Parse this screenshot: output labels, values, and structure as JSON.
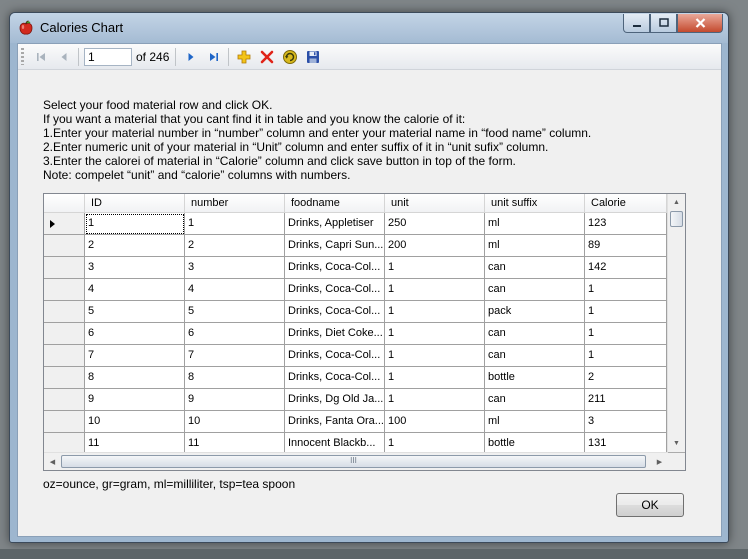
{
  "window": {
    "title": "Calories Chart",
    "icon": "apple-icon",
    "controls": {
      "minimize": "minimize-icon",
      "maximize": "maximize-icon",
      "close": "close-icon"
    }
  },
  "navigator": {
    "position": "1",
    "count_label": "of 246",
    "icons": [
      "move-first-icon",
      "move-previous-icon",
      "move-next-icon",
      "move-last-icon",
      "add-icon",
      "delete-icon",
      "refresh-icon",
      "save-icon"
    ]
  },
  "instructions": [
    "Select your food material row and click OK.",
    "If you want a material that you cant find it in table and you know the calorie of it:",
    "1.Enter your material number in “number” column and enter your material name in “food name” column.",
    "2.Enter numeric unit of your material in “Unit” column and enter suffix of it in “unit sufix” column.",
    "3.Enter the calorei of material in “Calorie” column and click save button in top of the form.",
    "Note: compelet “unit” and “calorie” columns with numbers."
  ],
  "grid": {
    "columns": [
      "ID",
      "number",
      "foodname",
      "unit",
      "unit suffix",
      "Calorie"
    ],
    "rows": [
      [
        "1",
        "1",
        "Drinks, Appletiser",
        "250",
        "ml",
        "123"
      ],
      [
        "2",
        "2",
        "Drinks, Capri Sun...",
        "200",
        "ml",
        "89"
      ],
      [
        "3",
        "3",
        "Drinks, Coca-Col...",
        "1",
        "can",
        "142"
      ],
      [
        "4",
        "4",
        "Drinks, Coca-Col...",
        "1",
        "can",
        "1"
      ],
      [
        "5",
        "5",
        "Drinks, Coca-Col...",
        "1",
        "pack",
        "1"
      ],
      [
        "6",
        "6",
        "Drinks, Diet Coke...",
        "1",
        "can",
        "1"
      ],
      [
        "7",
        "7",
        "Drinks, Coca-Col...",
        "1",
        "can",
        "1"
      ],
      [
        "8",
        "8",
        "Drinks, Coca-Col...",
        "1",
        "bottle",
        "2"
      ],
      [
        "9",
        "9",
        "Drinks, Dg Old Ja...",
        "1",
        "can",
        "211"
      ],
      [
        "10",
        "10",
        "Drinks, Fanta Ora...",
        "100",
        "ml",
        "3"
      ],
      [
        "11",
        "11",
        "Innocent Blackb...",
        "1",
        "bottle",
        "131"
      ]
    ],
    "current_row": 0,
    "hscroll_grip": "III"
  },
  "legend": "oz=ounce, gr=gram, ml=milliliter, tsp=tea spoon",
  "ok_label": "OK"
}
